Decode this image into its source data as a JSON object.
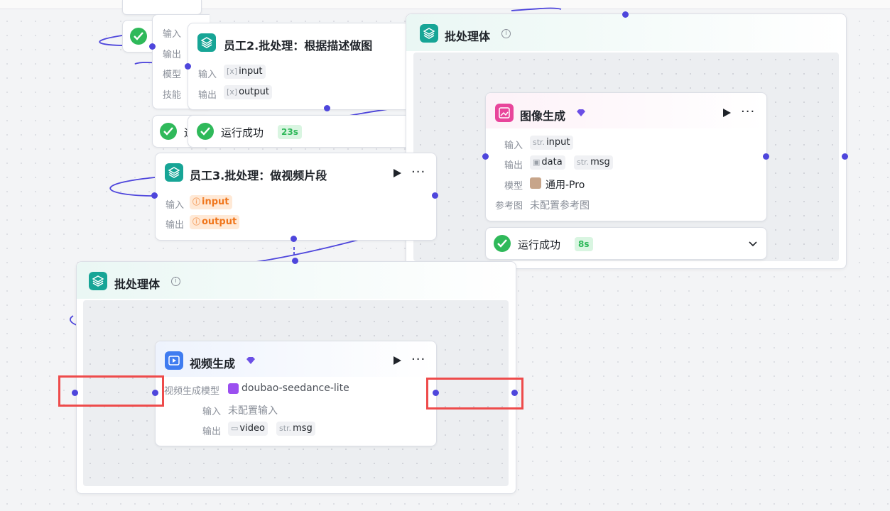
{
  "colors": {
    "accent": "#4e46dc",
    "success": "#2fb95a",
    "teal": "#17a596",
    "highlight": "#ee4b4b"
  },
  "employee2": {
    "title": "员工2.批处理：根据描述做图",
    "input_label": "输入",
    "input_value": "input",
    "output_label": "输出",
    "output_value": "output",
    "status": "运行成功",
    "duration": "23s"
  },
  "hidden_card": {
    "input_label": "输入",
    "output_label": "输出",
    "model_label": "模型",
    "skill_label": "技能",
    "status_char": "运"
  },
  "employee3": {
    "title": "员工3.批处理：做视频片段",
    "input_label": "输入",
    "input_value": "input",
    "output_label": "输出",
    "output_value": "output"
  },
  "batch_top": {
    "title": "批处理体"
  },
  "image_gen": {
    "title": "图像生成",
    "input_label": "输入",
    "input_type": "str.",
    "input_value": "input",
    "output_label": "输出",
    "output_value_1": "data",
    "output_type_2": "str.",
    "output_value_2": "msg",
    "model_label": "模型",
    "model_value": "通用-Pro",
    "ref_label": "参考图",
    "ref_value": "未配置参考图",
    "status": "运行成功",
    "duration": "8s"
  },
  "batch_bottom": {
    "title": "批处理体"
  },
  "video_gen": {
    "title": "视频生成",
    "model_label": "视频生成模型",
    "model_value": "doubao-seedance-lite",
    "input_label": "输入",
    "input_value": "未配置输入",
    "output_label": "输出",
    "output_value_1": "video",
    "output_type_2": "str.",
    "output_value_2": "msg"
  }
}
